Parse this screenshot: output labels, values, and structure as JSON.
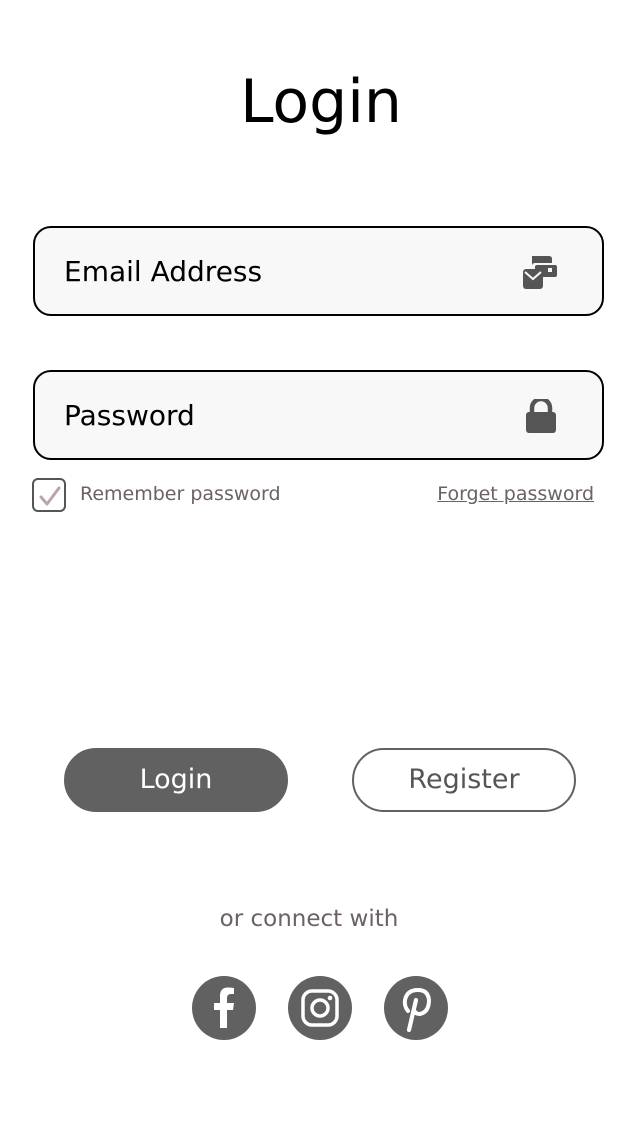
{
  "page": {
    "title": "Login"
  },
  "form": {
    "email_placeholder": "Email Address",
    "email_icon": "mail-card-icon",
    "password_placeholder": "Password",
    "password_icon": "lock-icon",
    "remember_label": "Remember password",
    "remember_checked": true,
    "forget_label": "Forget password"
  },
  "actions": {
    "login_label": "Login",
    "register_label": "Register"
  },
  "social": {
    "connect_text": "or connect with",
    "icons": [
      "facebook-icon",
      "instagram-icon",
      "pinterest-icon"
    ]
  },
  "colors": {
    "primary_button": "#616161",
    "muted_text": "#6b6262",
    "field_background": "#f8f8f8"
  }
}
